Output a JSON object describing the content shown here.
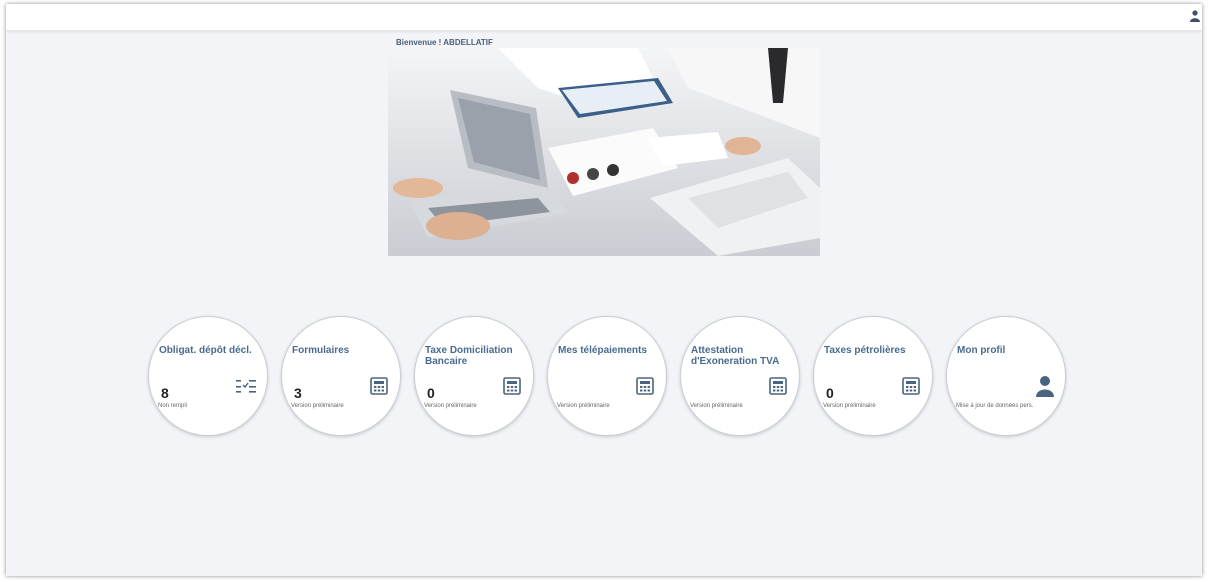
{
  "header": {
    "user_icon": "user-icon"
  },
  "welcome": {
    "text": "Bienvenue ! ABDELLATIF"
  },
  "hero": {
    "image": "office-meeting-photo"
  },
  "tiles": [
    {
      "title": "Obligat. dépôt décl.",
      "count": "8",
      "subtitle": "Non rempli",
      "icon": "checklist-icon"
    },
    {
      "title": "Formulaires",
      "count": "3",
      "subtitle": "Version préliminaire",
      "icon": "calculator-icon"
    },
    {
      "title": "Taxe Domiciliation Bancaire",
      "count": "0",
      "subtitle": "Version préliminaire",
      "icon": "calculator-icon"
    },
    {
      "title": "Mes télépaiements",
      "count": "",
      "subtitle": "Version préliminaire",
      "icon": "calculator-icon"
    },
    {
      "title": "Attestation d'Exoneration TVA",
      "count": "",
      "subtitle": "Version préliminaire",
      "icon": "calculator-icon"
    },
    {
      "title": "Taxes pétrolières",
      "count": "0",
      "subtitle": "Version préliminaire",
      "icon": "calculator-icon"
    },
    {
      "title": "Mon profil",
      "count": "",
      "subtitle": "Mise à jour de données pers.",
      "icon": "person-icon"
    }
  ],
  "colors": {
    "background": "#f2f4f8",
    "title": "#4a6b8f",
    "icon": "#4a6480"
  }
}
